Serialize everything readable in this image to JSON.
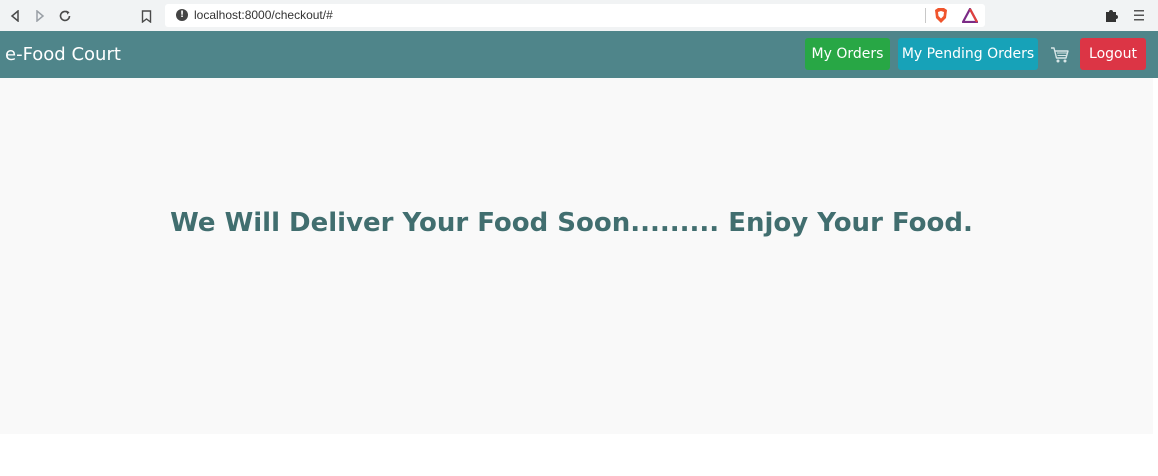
{
  "browser": {
    "back_icon": "back-arrow-icon",
    "forward_icon": "forward-arrow-icon",
    "reload_icon": "reload-icon",
    "bookmark_icon": "bookmark-icon",
    "url": "localhost:8000/checkout/#",
    "info_icon_glyph": "!"
  },
  "navbar": {
    "brand": "e-Food Court",
    "my_orders_label": "My Orders",
    "my_pending_orders_label": "My Pending Orders",
    "logout_label": "Logout",
    "colors": {
      "navbar_bg": "#4f858a",
      "my_orders_bg": "#28a745",
      "pending_bg": "#17a2b8",
      "logout_bg": "#dc3545"
    }
  },
  "main": {
    "message": "We Will Deliver Your Food Soon......... Enjoy Your Food.",
    "message_color": "#416e6f",
    "background": "#f9f9f9"
  }
}
